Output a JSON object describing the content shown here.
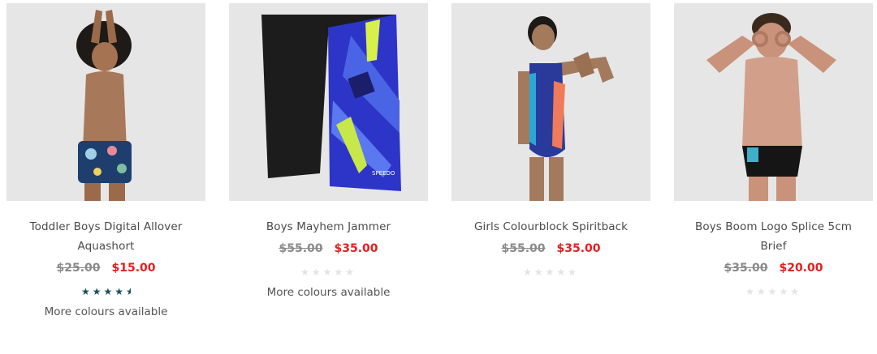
{
  "products": [
    {
      "title": "Toddler Boys Digital Allover Aquashort",
      "was_price": "$25.00",
      "price": "$15.00",
      "rating": 4.5,
      "more": "More colours available"
    },
    {
      "title": "Boys Mayhem Jammer",
      "was_price": "$55.00",
      "price": "$35.00",
      "rating": 0,
      "more": "More colours available"
    },
    {
      "title": "Girls Colourblock Spiritback",
      "was_price": "$55.00",
      "price": "$35.00",
      "rating": 0,
      "more": ""
    },
    {
      "title": "Boys Boom Logo Splice 5cm Brief",
      "was_price": "$35.00",
      "price": "$20.00",
      "rating": 0,
      "more": ""
    }
  ],
  "colors": {
    "sale": "#e02020",
    "was": "#8a8a8a",
    "star_filled": "#174e5c",
    "star_empty": "#e3e3e3"
  },
  "icons": {
    "star": "star-icon"
  }
}
